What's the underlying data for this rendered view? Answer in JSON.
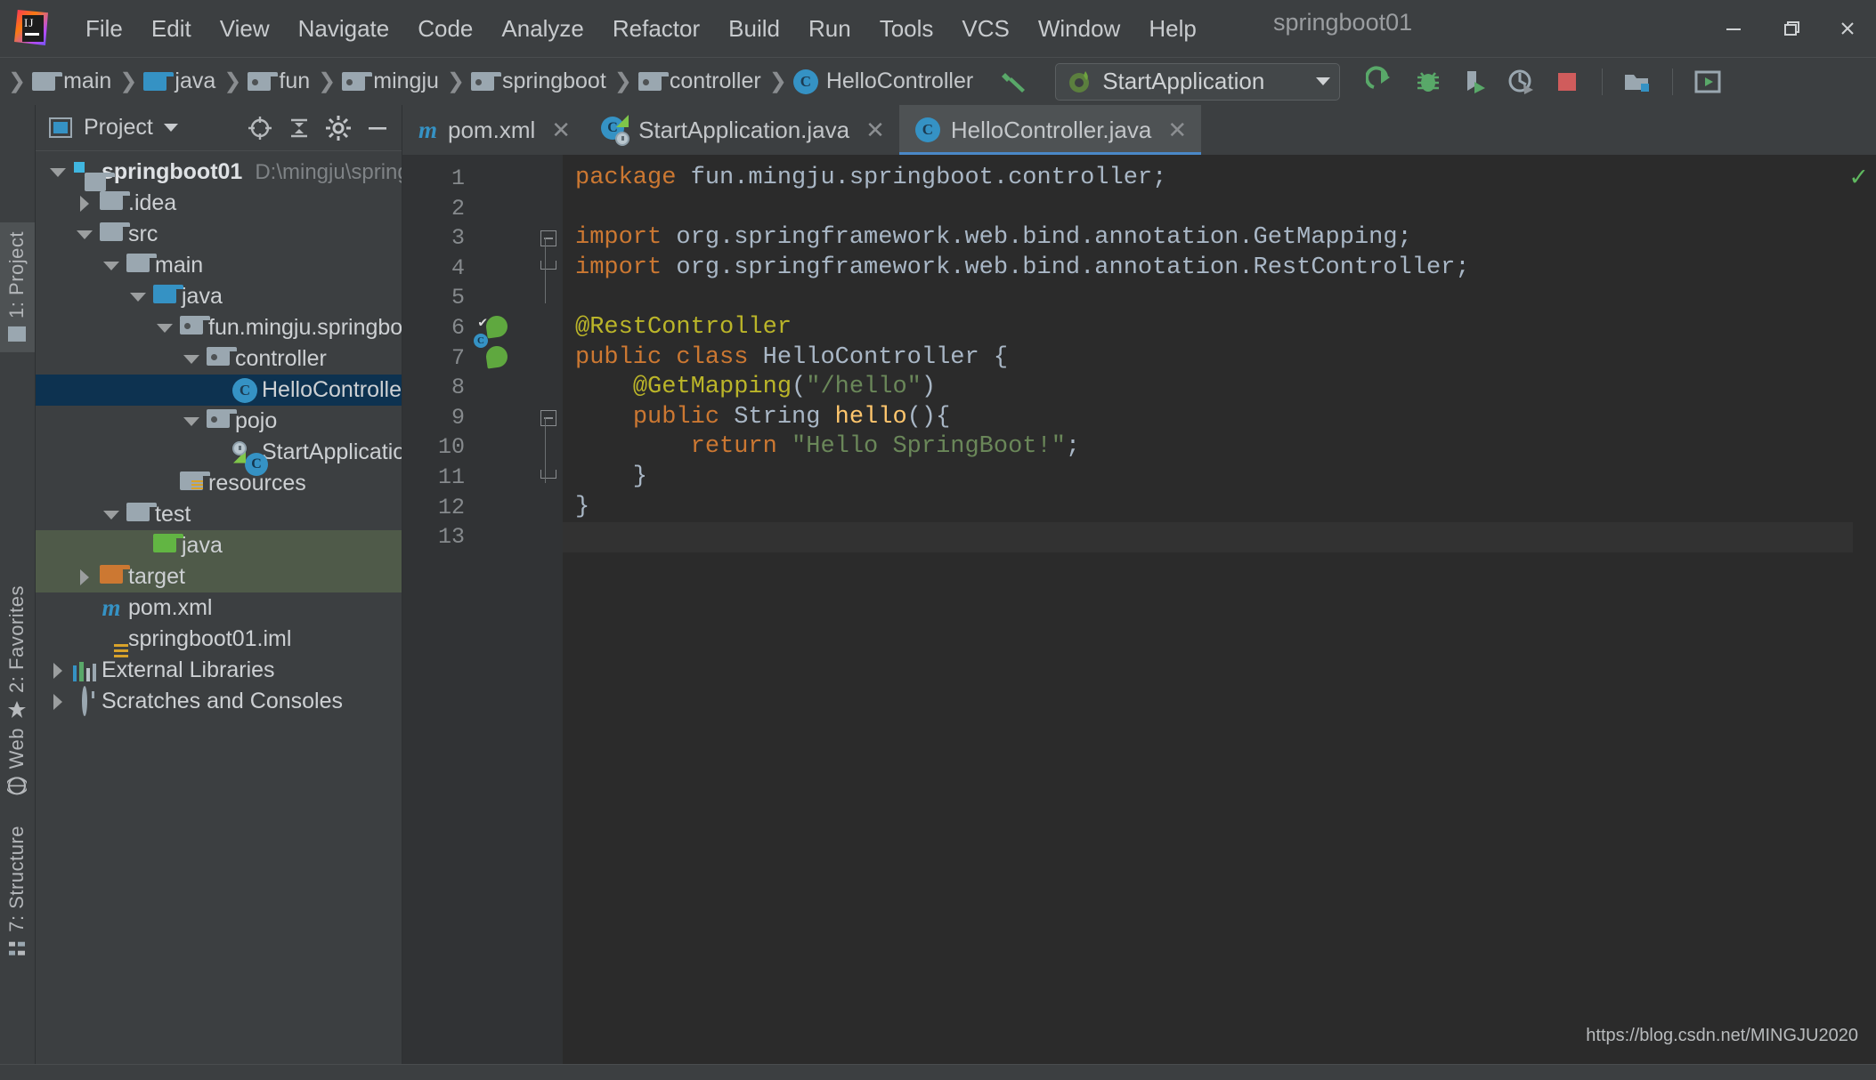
{
  "window": {
    "title": "springboot01",
    "minimize_label": "─",
    "maximize_label": "❐",
    "close_label": "✕"
  },
  "menu": {
    "items": [
      {
        "label": "File",
        "mnemonic": "F"
      },
      {
        "label": "Edit",
        "mnemonic": "E"
      },
      {
        "label": "View",
        "mnemonic": "V"
      },
      {
        "label": "Navigate",
        "mnemonic": "N"
      },
      {
        "label": "Code",
        "mnemonic": "C"
      },
      {
        "label": "Analyze",
        "mnemonic": "z"
      },
      {
        "label": "Refactor",
        "mnemonic": "R"
      },
      {
        "label": "Build",
        "mnemonic": "B"
      },
      {
        "label": "Run",
        "mnemonic": "u"
      },
      {
        "label": "Tools",
        "mnemonic": "T"
      },
      {
        "label": "VCS",
        "mnemonic": "S"
      },
      {
        "label": "Window",
        "mnemonic": "W"
      },
      {
        "label": "Help",
        "mnemonic": "H"
      }
    ]
  },
  "breadcrumb": {
    "items": [
      {
        "label": "main",
        "icon": "folder-grey"
      },
      {
        "label": "java",
        "icon": "folder-blue"
      },
      {
        "label": "fun",
        "icon": "folder-package"
      },
      {
        "label": "mingju",
        "icon": "folder-package"
      },
      {
        "label": "springboot",
        "icon": "folder-package"
      },
      {
        "label": "controller",
        "icon": "folder-package"
      },
      {
        "label": "HelloController",
        "icon": "class-icon"
      }
    ]
  },
  "toolbar": {
    "build_icon": "hammer-icon",
    "run_config": {
      "label": "StartApplication",
      "icon": "spring-boot-icon"
    },
    "actions": [
      {
        "name": "run-button",
        "icon": "run-arrow-icon"
      },
      {
        "name": "debug-button",
        "icon": "bug-icon"
      },
      {
        "name": "run-with-profiler-button",
        "icon": "profiler-icon"
      },
      {
        "name": "run-with-coverage-button",
        "icon": "coverage-icon"
      },
      {
        "name": "stop-button",
        "icon": "stop-square-icon"
      },
      {
        "name": "project-structure-button",
        "icon": "module-folder-icon"
      },
      {
        "name": "search-everywhere-button",
        "icon": "screen-play-icon"
      }
    ]
  },
  "left_rail": [
    {
      "label": "1: Project",
      "active": true,
      "icon": "project-panel-icon"
    },
    {
      "label": "2: Favorites",
      "active": false,
      "icon": "star-icon"
    },
    {
      "label": "Web",
      "active": false,
      "icon": "globe-icon"
    },
    {
      "label": "7: Structure",
      "active": false,
      "icon": "structure-icon"
    }
  ],
  "project_panel": {
    "title": "Project",
    "actions": [
      {
        "name": "locate-in-tree-button",
        "icon": "crosshair-icon"
      },
      {
        "name": "collapse-all-button",
        "icon": "collapse-icon"
      },
      {
        "name": "settings-button",
        "icon": "gear-icon"
      },
      {
        "name": "hide-button",
        "icon": "minus-icon"
      }
    ],
    "tree": [
      {
        "label": "springboot01",
        "path": "D:\\mingju\\springboo",
        "indent": 0,
        "arrow": "down",
        "icon": "module-icon",
        "bold": true,
        "state": "normal"
      },
      {
        "label": ".idea",
        "path": "",
        "indent": 1,
        "arrow": "right",
        "icon": "folder-grey",
        "bold": false,
        "state": "normal"
      },
      {
        "label": "src",
        "path": "",
        "indent": 1,
        "arrow": "down",
        "icon": "folder-grey",
        "bold": false,
        "state": "normal"
      },
      {
        "label": "main",
        "path": "",
        "indent": 2,
        "arrow": "down",
        "icon": "folder-grey",
        "bold": false,
        "state": "normal"
      },
      {
        "label": "java",
        "path": "",
        "indent": 3,
        "arrow": "down",
        "icon": "folder-blue",
        "bold": false,
        "state": "normal"
      },
      {
        "label": "fun.mingju.springboot",
        "path": "",
        "indent": 4,
        "arrow": "down",
        "icon": "folder-package",
        "bold": false,
        "state": "normal"
      },
      {
        "label": "controller",
        "path": "",
        "indent": 5,
        "arrow": "down",
        "icon": "folder-package",
        "bold": false,
        "state": "normal"
      },
      {
        "label": "HelloController",
        "path": "",
        "indent": 6,
        "arrow": "none",
        "icon": "class-icon",
        "bold": false,
        "state": "selected"
      },
      {
        "label": "pojo",
        "path": "",
        "indent": 5,
        "arrow": "down",
        "icon": "folder-package",
        "bold": false,
        "state": "normal"
      },
      {
        "label": "StartApplication",
        "path": "",
        "indent": 6,
        "arrow": "none",
        "icon": "spring-class-icon",
        "bold": false,
        "state": "normal"
      },
      {
        "label": "resources",
        "path": "",
        "indent": 4,
        "arrow": "none",
        "icon": "folder-resources",
        "bold": false,
        "state": "normal"
      },
      {
        "label": "test",
        "path": "",
        "indent": 2,
        "arrow": "down",
        "icon": "folder-grey",
        "bold": false,
        "state": "normal"
      },
      {
        "label": "java",
        "path": "",
        "indent": 3,
        "arrow": "none",
        "icon": "folder-green",
        "bold": false,
        "state": "greenbg"
      },
      {
        "label": "target",
        "path": "",
        "indent": 1,
        "arrow": "right",
        "icon": "folder-orange",
        "bold": false,
        "state": "greenbg"
      },
      {
        "label": "pom.xml",
        "path": "",
        "indent": 1,
        "arrow": "none",
        "icon": "maven-icon",
        "bold": false,
        "state": "normal"
      },
      {
        "label": "springboot01.iml",
        "path": "",
        "indent": 1,
        "arrow": "none",
        "icon": "iml-icon",
        "bold": false,
        "state": "normal"
      },
      {
        "label": "External Libraries",
        "path": "",
        "indent": 0,
        "arrow": "right",
        "icon": "library-icon",
        "bold": false,
        "state": "normal"
      },
      {
        "label": "Scratches and Consoles",
        "path": "",
        "indent": 0,
        "arrow": "right",
        "icon": "scratches-icon",
        "bold": false,
        "state": "normal"
      }
    ]
  },
  "editor": {
    "tabs": [
      {
        "label": "pom.xml",
        "icon": "maven-icon",
        "active": false,
        "closable": true
      },
      {
        "label": "StartApplication.java",
        "icon": "spring-class-icon",
        "active": false,
        "closable": true
      },
      {
        "label": "HelloController.java",
        "icon": "class-icon",
        "active": true,
        "closable": true
      }
    ],
    "inspection_status": "✓",
    "line_numbers": [
      1,
      2,
      3,
      4,
      5,
      6,
      7,
      8,
      9,
      10,
      11,
      12,
      13
    ],
    "gutter_icons": [
      {
        "line": 6,
        "icon": "spring-bean-check-icon"
      },
      {
        "line": 7,
        "icon": "spring-bean-class-icon"
      }
    ],
    "code_lines": [
      {
        "n": 1,
        "tokens": [
          {
            "t": "package ",
            "c": "kw"
          },
          {
            "t": "fun.mingju.springboot.controller;",
            "c": "pl"
          }
        ]
      },
      {
        "n": 2,
        "tokens": []
      },
      {
        "n": 3,
        "tokens": [
          {
            "t": "import ",
            "c": "kw"
          },
          {
            "t": "org.springframework.web.bind.annotation.GetMapping;",
            "c": "pl"
          }
        ]
      },
      {
        "n": 4,
        "tokens": [
          {
            "t": "import ",
            "c": "kw"
          },
          {
            "t": "org.springframework.web.bind.annotation.RestController;",
            "c": "pl"
          }
        ]
      },
      {
        "n": 5,
        "tokens": []
      },
      {
        "n": 6,
        "tokens": [
          {
            "t": "@RestController",
            "c": "ann"
          }
        ]
      },
      {
        "n": 7,
        "tokens": [
          {
            "t": "public class ",
            "c": "kw"
          },
          {
            "t": "HelloController ",
            "c": "cls"
          },
          {
            "t": "{",
            "c": "pl"
          }
        ]
      },
      {
        "n": 8,
        "tokens": [
          {
            "t": "    ",
            "c": "pl"
          },
          {
            "t": "@GetMapping",
            "c": "ann"
          },
          {
            "t": "(",
            "c": "pl"
          },
          {
            "t": "\"/hello\"",
            "c": "str"
          },
          {
            "t": ")",
            "c": "pl"
          }
        ]
      },
      {
        "n": 9,
        "tokens": [
          {
            "t": "    ",
            "c": "pl"
          },
          {
            "t": "public ",
            "c": "kw"
          },
          {
            "t": "String ",
            "c": "cls"
          },
          {
            "t": "hello",
            "c": "mth"
          },
          {
            "t": "(){",
            "c": "pl"
          }
        ]
      },
      {
        "n": 10,
        "tokens": [
          {
            "t": "        ",
            "c": "pl"
          },
          {
            "t": "return ",
            "c": "kw"
          },
          {
            "t": "\"Hello SpringBoot!\"",
            "c": "str"
          },
          {
            "t": ";",
            "c": "pl"
          }
        ]
      },
      {
        "n": 11,
        "tokens": [
          {
            "t": "    }",
            "c": "pl"
          }
        ]
      },
      {
        "n": 12,
        "tokens": [
          {
            "t": "}",
            "c": "pl"
          }
        ]
      },
      {
        "n": 13,
        "tokens": []
      }
    ],
    "fold_markers": [
      {
        "line": 3,
        "type": "minus-expanded"
      },
      {
        "line": 4,
        "type": "bracket-end"
      },
      {
        "line": 9,
        "type": "minus"
      },
      {
        "line": 11,
        "type": "bracket-end"
      }
    ]
  },
  "watermark": "https://blog.csdn.net/MINGJU2020",
  "colors": {
    "accent_blue": "#3592c4",
    "selection_blue": "#0d3250",
    "keyword_orange": "#cc7832",
    "annotation_yellow": "#bbb529",
    "string_green": "#6a8759",
    "method_yellow": "#ffc66d",
    "editor_bg": "#2b2b2b",
    "panel_bg": "#3c3f41"
  }
}
